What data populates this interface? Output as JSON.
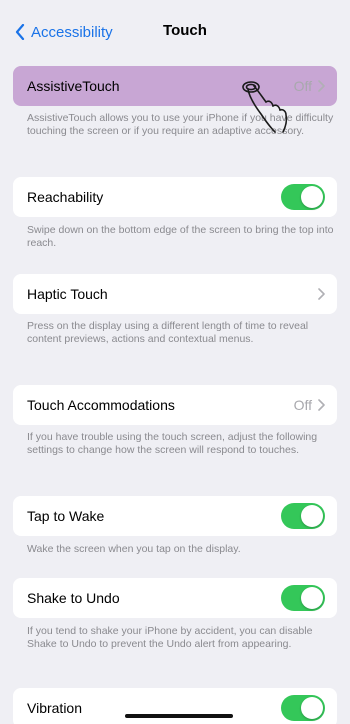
{
  "nav": {
    "back_label": "Accessibility",
    "title": "Touch"
  },
  "rows": {
    "assistive": {
      "label": "AssistiveTouch",
      "value": "Off",
      "footer": "AssistiveTouch allows you to use your iPhone if you have difficulty touching the screen or if you require an adaptive accessory."
    },
    "reachability": {
      "label": "Reachability",
      "state": "on",
      "footer": "Swipe down on the bottom edge of the screen to bring the top into reach."
    },
    "haptic": {
      "label": "Haptic Touch",
      "footer": "Press on the display using a different length of time to reveal content previews, actions and contextual menus."
    },
    "accommodations": {
      "label": "Touch Accommodations",
      "value": "Off",
      "footer": "If you have trouble using the touch screen, adjust the following settings to change how the screen will respond to touches."
    },
    "tap_to_wake": {
      "label": "Tap to Wake",
      "state": "on",
      "footer": "Wake the screen when you tap on the display."
    },
    "shake_to_undo": {
      "label": "Shake to Undo",
      "state": "on",
      "footer": "If you tend to shake your iPhone by accident, you can disable Shake to Undo to prevent the Undo alert from appearing."
    },
    "vibration": {
      "label": "Vibration",
      "state": "on"
    }
  },
  "colors": {
    "accent": "#1a73e8",
    "toggle_on": "#34c759",
    "highlight": "#c8a6d4",
    "background": "#efeff4"
  },
  "icons": [
    "chevron-left-icon",
    "chevron-right-icon",
    "pointing-hand-icon"
  ]
}
